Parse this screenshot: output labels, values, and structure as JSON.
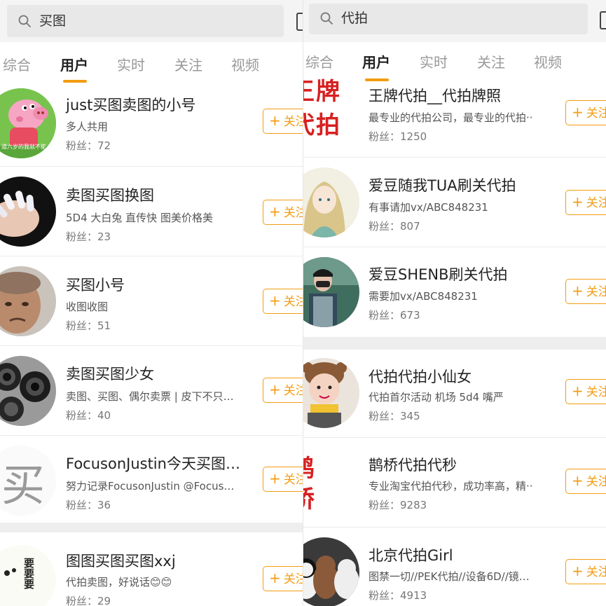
{
  "left": {
    "search": {
      "query": "买图"
    },
    "tabs": [
      {
        "label": "综合",
        "active": false
      },
      {
        "label": "用户",
        "active": true
      },
      {
        "label": "实时",
        "active": false
      },
      {
        "label": "关注",
        "active": false
      },
      {
        "label": "视频",
        "active": false
      }
    ],
    "users": [
      {
        "name": "just买图卖图的小号",
        "desc": "多人共用",
        "fans": "粉丝：72",
        "avatar_caption": "道六岁的我就不能"
      },
      {
        "name": "卖图买图换图",
        "desc": "5D4 大白兔 直传快 图美价格美",
        "fans": "粉丝：23"
      },
      {
        "name": "买图小号",
        "desc": "收图收图",
        "fans": "粉丝：51"
      },
      {
        "name": "卖图买图少女",
        "desc": "卖图、买图、偶尔卖票 | 皮下不只…",
        "fans": "粉丝：40"
      },
      {
        "name": "FocusonJustin今天买图…",
        "desc": "努力记录FocusonJustin @Focus…",
        "fans": "粉丝：36",
        "avatar_caption": "买"
      },
      {
        "name": "图图买图买图xxj",
        "desc": "代拍卖图，好说话😊😊",
        "fans": "粉丝：29",
        "avatar_caption": "要要要"
      }
    ],
    "follow_label": "关注"
  },
  "right": {
    "search": {
      "query": "代拍"
    },
    "tabs": [
      {
        "label": "综合",
        "active": false
      },
      {
        "label": "用户",
        "active": true
      },
      {
        "label": "实时",
        "active": false
      },
      {
        "label": "关注",
        "active": false
      },
      {
        "label": "视频",
        "active": false
      }
    ],
    "users": [
      {
        "name": "王牌代拍__代拍牌照",
        "desc": "最专业的代拍公司，最专业的代拍··",
        "fans": "粉丝：1250",
        "avatar_caption": "王牌代拍"
      },
      {
        "name": "爱豆随我TUA刷关代拍",
        "desc": "有事请加vx/ABC848231",
        "fans": "粉丝：807"
      },
      {
        "name": "爱豆SHENB刷关代拍",
        "desc": "需要加vx/ABC848231",
        "fans": "粉丝：673"
      },
      {
        "name": "代拍代拍小仙女",
        "desc": "代拍首尔活动 机场 5d4 嘴严",
        "fans": "粉丝：345"
      },
      {
        "name": "鹊桥代拍代秒",
        "desc": "专业淘宝代拍代秒，成功率高，精··",
        "fans": "粉丝：9283",
        "avatar_caption": "鹊桥代拍"
      },
      {
        "name": "北京代拍Girl",
        "desc": "图禁一切//PEK代拍//设备6D//镜…",
        "fans": "粉丝：4913"
      }
    ],
    "follow_label": "关注"
  },
  "colors": {
    "accent": "#f39c12",
    "background": "#ffffff",
    "separator": "#eeeeee"
  }
}
